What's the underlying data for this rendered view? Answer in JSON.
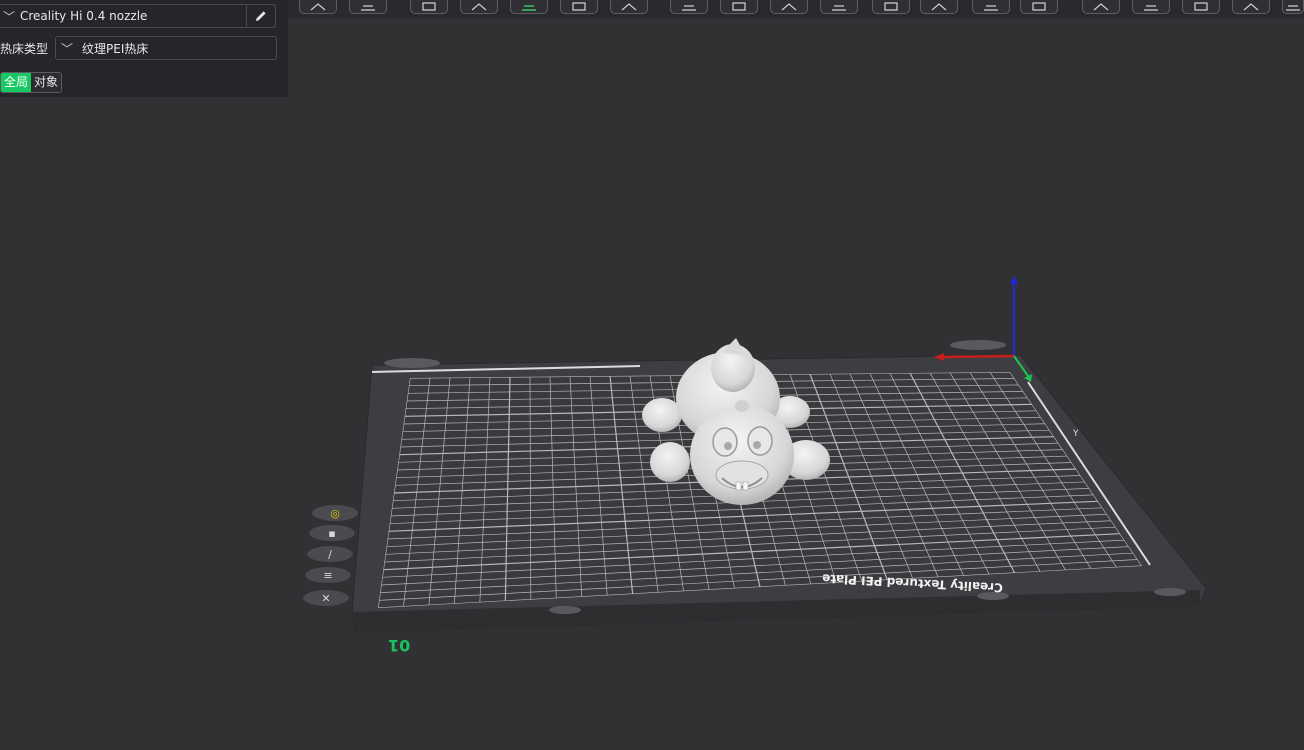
{
  "printer": {
    "selected": "Creality Hi 0.4 nozzle",
    "chevron_icon": "chevron-down-icon",
    "edit_icon": "pencil-icon"
  },
  "bed": {
    "label": "热床类型",
    "selected": "纹理PEI热床"
  },
  "scope_tabs": {
    "global": "全局",
    "object": "对象",
    "active": "global"
  },
  "toolbar_icons": [
    "cube-view-icon",
    "grid-view-icon",
    "add-object-icon",
    "shape-icon",
    "split-plate-icon",
    "arrange-icon",
    "slice-icon",
    "layout-icon",
    "settings-icon",
    "measure-icon",
    "support-icon",
    "cut-icon",
    "paint-icon",
    "box-icon",
    "text-icon",
    "mesh-icon",
    "assembly-icon",
    "network-icon",
    "clock-icon",
    "text-tool-icon"
  ],
  "viewport": {
    "plate_number": "01",
    "plate_brand": "Creality Textured PEI Plate",
    "side_tools": [
      "ring-icon",
      "camera-icon",
      "wand-icon",
      "menu-icon",
      "close-icon"
    ],
    "accent_color": "#17c964"
  }
}
